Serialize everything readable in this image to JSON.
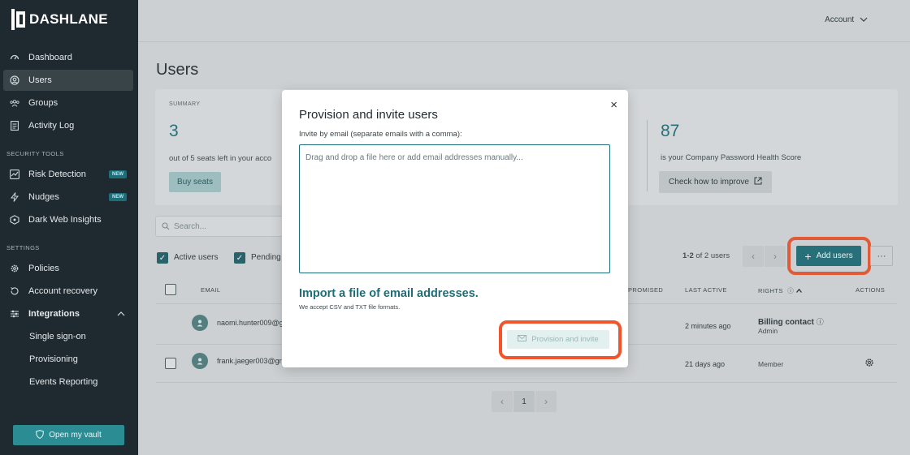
{
  "brand": {
    "name": "DASHLANE"
  },
  "sidebar": {
    "main_items": [
      {
        "label": "Dashboard",
        "icon": "dashboard-icon"
      },
      {
        "label": "Users",
        "icon": "users-icon",
        "active": true
      },
      {
        "label": "Groups",
        "icon": "groups-icon"
      },
      {
        "label": "Activity Log",
        "icon": "activity-log-icon"
      }
    ],
    "security_label": "SECURITY TOOLS",
    "security_items": [
      {
        "label": "Risk Detection",
        "badge": "NEW"
      },
      {
        "label": "Nudges",
        "badge": "NEW"
      },
      {
        "label": "Dark Web Insights"
      }
    ],
    "settings_label": "SETTINGS",
    "settings_items": [
      {
        "label": "Policies"
      },
      {
        "label": "Account recovery"
      },
      {
        "label": "Integrations"
      }
    ],
    "integration_subitems": [
      {
        "label": "Single sign-on"
      },
      {
        "label": "Provisioning"
      },
      {
        "label": "Events Reporting"
      }
    ],
    "vault_button": "Open my vault"
  },
  "header": {
    "account_label": "Account"
  },
  "page": {
    "title": "Users",
    "summary": {
      "label": "SUMMARY",
      "seats_left": "3",
      "seats_text": "out of 5 seats left in your acco",
      "buy_label": "Buy seats",
      "health_score": "87",
      "health_text": "is your Company Password Health Score",
      "improve_label": "Check how to improve"
    },
    "search_placeholder": "Search...",
    "filters": {
      "active": "Active users",
      "pending": "Pending"
    },
    "pagination": {
      "range": "1-2",
      "suffix": "of 2 users",
      "current_page": "1"
    },
    "add_users_label": "Add users",
    "more_label": "···",
    "table": {
      "headers": {
        "email": "EMAIL",
        "compromised": "PROMISED",
        "last_active": "LAST ACTIVE",
        "rights": "RIGHTS",
        "actions": "ACTIONS"
      },
      "rows": [
        {
          "email": "naomi.hunter009@g",
          "last_active": "2 minutes ago",
          "rights_title": "Billing contact",
          "rights_role": "Admin"
        },
        {
          "email": "frank.jaeger003@gr",
          "last_active": "21 days ago",
          "rights_role": "Member"
        }
      ]
    }
  },
  "modal": {
    "title": "Provision and invite users",
    "close": "×",
    "instruction": "Invite by email (separate emails with a comma):",
    "placeholder": "Drag and drop a file here or add email addresses manually...",
    "import_link": "Import a file of email addresses.",
    "import_note": "We accept CSV and TXT file formats.",
    "submit_label": "Provision and invite"
  },
  "colors": {
    "accent": "#1d6e78",
    "highlight": "#f2552c",
    "sidebar": "#1f2a30"
  }
}
